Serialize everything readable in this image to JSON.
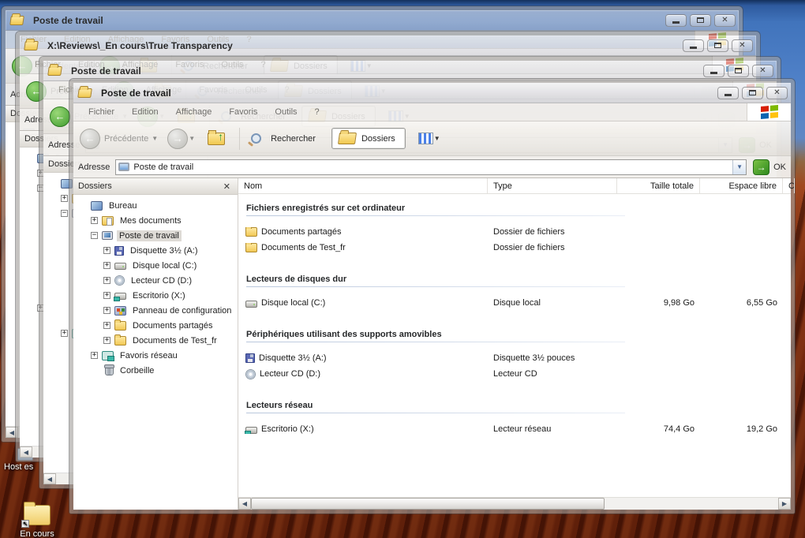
{
  "desktop": {
    "host_icon_label": "Host es",
    "shortcut_label": "En cours"
  },
  "ghost_windows": [
    {
      "title": "Poste de travail"
    },
    {
      "title": "X:\\Reviews\\_En cours\\True Transparency"
    },
    {
      "title": "Poste de travail"
    }
  ],
  "window": {
    "title": "Poste de travail",
    "menu": [
      "Fichier",
      "Edition",
      "Affichage",
      "Favoris",
      "Outils",
      "?"
    ],
    "toolbar": {
      "back_label": "Précédente",
      "search_label": "Rechercher",
      "folders_label": "Dossiers"
    },
    "address": {
      "label": "Adresse",
      "value": "Poste de travail",
      "ok_label": "OK"
    },
    "folders_panel": {
      "header": "Dossiers",
      "tree": [
        {
          "label": "Bureau",
          "icon": "desktop",
          "depth": 0,
          "expander": ""
        },
        {
          "label": "Mes documents",
          "icon": "mydocs",
          "depth": 1,
          "expander": "+"
        },
        {
          "label": "Poste de travail",
          "icon": "computer",
          "depth": 1,
          "expander": "-",
          "selected": true
        },
        {
          "label": "Disquette 3½ (A:)",
          "icon": "floppy",
          "depth": 2,
          "expander": "+"
        },
        {
          "label": "Disque local (C:)",
          "icon": "drive",
          "depth": 2,
          "expander": "+"
        },
        {
          "label": "Lecteur CD (D:)",
          "icon": "cd",
          "depth": 2,
          "expander": "+"
        },
        {
          "label": "Escritorio (X:)",
          "icon": "netdrive",
          "depth": 2,
          "expander": "+"
        },
        {
          "label": "Panneau de configuration",
          "icon": "cpanel",
          "depth": 2,
          "expander": "+"
        },
        {
          "label": "Documents partagés",
          "icon": "folder",
          "depth": 2,
          "expander": "+"
        },
        {
          "label": "Documents de Test_fr",
          "icon": "folder",
          "depth": 2,
          "expander": "+"
        },
        {
          "label": "Favoris réseau",
          "icon": "network",
          "depth": 1,
          "expander": "+"
        },
        {
          "label": "Corbeille",
          "icon": "recycle",
          "depth": 1,
          "expander": ""
        }
      ]
    },
    "columns": [
      "Nom",
      "Type",
      "Taille totale",
      "Espace libre",
      "C"
    ],
    "groups": [
      {
        "header": "Fichiers enregistrés sur cet ordinateur",
        "items": [
          {
            "name": "Documents partagés",
            "icon": "folder",
            "type": "Dossier de fichiers",
            "size": "",
            "free": ""
          },
          {
            "name": "Documents de Test_fr",
            "icon": "folder",
            "type": "Dossier de fichiers",
            "size": "",
            "free": ""
          }
        ]
      },
      {
        "header": "Lecteurs de disques dur",
        "items": [
          {
            "name": "Disque local (C:)",
            "icon": "drive",
            "type": "Disque local",
            "size": "9,98 Go",
            "free": "6,55 Go"
          }
        ]
      },
      {
        "header": "Périphériques utilisant des supports amovibles",
        "items": [
          {
            "name": "Disquette 3½ (A:)",
            "icon": "floppy",
            "type": "Disquette 3½ pouces",
            "size": "",
            "free": ""
          },
          {
            "name": "Lecteur CD (D:)",
            "icon": "cd",
            "type": "Lecteur CD",
            "size": "",
            "free": ""
          }
        ]
      },
      {
        "header": "Lecteurs réseau",
        "items": [
          {
            "name": "Escritorio (X:)",
            "icon": "netdrive",
            "type": "Lecteur réseau",
            "size": "74,4 Go",
            "free": "19,2 Go"
          }
        ]
      }
    ]
  }
}
